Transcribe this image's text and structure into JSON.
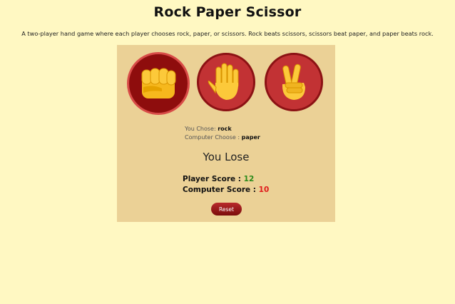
{
  "header": {
    "title": "Rock Paper Scissor",
    "description": "A two-player hand game where each player chooses rock, paper, or scissors. Rock beats scissors, scissors beat paper, and paper beats rock."
  },
  "choices": [
    {
      "name": "rock",
      "icon": "fist-icon",
      "selected": true
    },
    {
      "name": "paper",
      "icon": "open-hand-icon",
      "selected": false
    },
    {
      "name": "scissors",
      "icon": "victory-hand-icon",
      "selected": false
    }
  ],
  "round": {
    "user_label": "You Chose:",
    "user_choice": "rock",
    "computer_label": "Computer Choose :",
    "computer_choice": "paper",
    "result": "You Lose"
  },
  "scores": {
    "player_label": "Player Score :",
    "player_value": "12",
    "computer_label": "Computer Score :",
    "computer_value": "10"
  },
  "controls": {
    "reset_label": "Reset"
  },
  "colors": {
    "background": "#fff8c2",
    "card": "#ebd196",
    "button_red": "#c23234",
    "win_green": "#2a8a1a",
    "lose_red": "#e01b1b"
  }
}
